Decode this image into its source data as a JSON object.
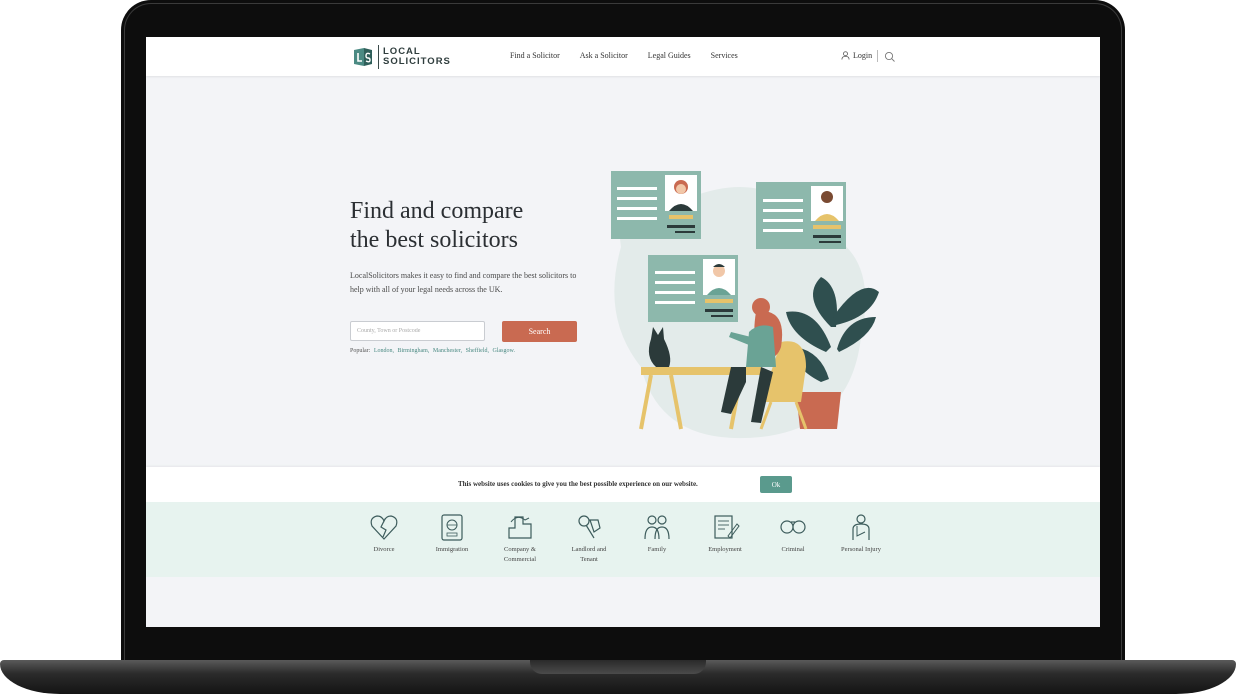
{
  "header": {
    "logo_top": "LOCAL",
    "logo_bottom": "SOLICITORS",
    "nav": [
      "Find a Solicitor",
      "Ask a Solicitor",
      "Legal Guides",
      "Services"
    ],
    "login_label": "Login"
  },
  "hero": {
    "title_line1": "Find and compare",
    "title_line2": "the best solicitors",
    "description": "LocalSolicitors makes it easy to find and compare the best solicitors to help with all of your legal needs across the UK.",
    "search_placeholder": "County, Town or Postcode",
    "search_button": "Search",
    "popular_label": "Popular:",
    "popular_links": [
      "London,",
      "Birmingham,",
      "Manchester,",
      "Sheffield,",
      "Glasgow."
    ]
  },
  "cookie": {
    "text": "This website uses cookies to give you the best possible experience on our website.",
    "ok_label": "Ok"
  },
  "categories": [
    {
      "label": "Divorce",
      "icon": "broken-heart-icon"
    },
    {
      "label": "Immigration",
      "icon": "passport-icon"
    },
    {
      "label": "Company &",
      "label2": "Commercial",
      "icon": "company-icon"
    },
    {
      "label": "Landlord and",
      "label2": "Tenant",
      "icon": "keys-icon"
    },
    {
      "label": "Family",
      "icon": "family-icon"
    },
    {
      "label": "Employment",
      "icon": "contract-icon"
    },
    {
      "label": "Criminal",
      "icon": "handcuffs-icon"
    },
    {
      "label": "Personal Injury",
      "icon": "injured-person-icon"
    }
  ],
  "colors": {
    "brand_green": "#4b8a83",
    "search_button": "#c96a51",
    "category_band": "#e7f3ef",
    "ok_button": "#5a9a8d"
  }
}
